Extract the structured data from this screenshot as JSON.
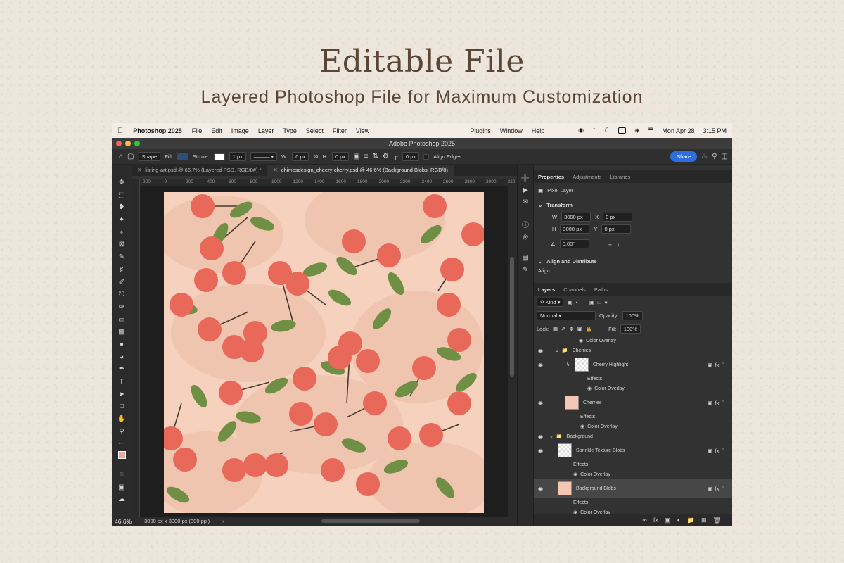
{
  "hero": {
    "title": "Editable File",
    "subtitle": "Layered Photoshop File for Maximum Customization"
  },
  "menubar": {
    "app_name": "Photoshop 2025",
    "items": [
      "File",
      "Edit",
      "Image",
      "Layer",
      "Type",
      "Select",
      "Filter",
      "View"
    ],
    "right_items": [
      "Plugins",
      "Window",
      "Help"
    ],
    "date": "Mon Apr 28",
    "time": "3:15 PM"
  },
  "window": {
    "title": "Adobe Photoshop 2025"
  },
  "optionsbar": {
    "shape_mode": "Shape",
    "fill_label": "Fill:",
    "stroke_label": "Stroke:",
    "stroke_width": "1 px",
    "w_label": "W:",
    "w_value": "0 px",
    "h_label": "H:",
    "h_value": "0 px",
    "corner_value": "0 px",
    "align_edges": "Align Edges",
    "share": "Share"
  },
  "tabs": [
    {
      "label": "listing-art.psd @ 66.7% (Layered PSD, RGB/8#) *"
    },
    {
      "label": "chimesdesign_cheery-cherry.psd @ 46.6% (Background Blobs, RGB/8)"
    }
  ],
  "ruler": [
    "200",
    "0",
    "200",
    "400",
    "600",
    "800",
    "1000",
    "1200",
    "1400",
    "1600",
    "1800",
    "2000",
    "2200",
    "2400",
    "2600",
    "2800",
    "3000",
    "320"
  ],
  "status": {
    "zoom": "46.6%",
    "doc_size": "3000 px x 3000 px (300 ppi)"
  },
  "properties": {
    "tabs": [
      "Properties",
      "Adjustments",
      "Libraries"
    ],
    "kind": "Pixel Layer",
    "transform": "Transform",
    "w": "3000 px",
    "h": "3000 px",
    "x": "0 px",
    "y": "0 px",
    "angle": "0.00°",
    "align_distribute": "Align and Distribute",
    "align_label": "Align:"
  },
  "layers": {
    "tabs": [
      "Layers",
      "Channels",
      "Paths"
    ],
    "filter": "Kind",
    "blend": "Normal",
    "opacity_label": "Opacity:",
    "opacity": "100%",
    "lock_label": "Lock:",
    "fill_label": "Fill:",
    "fill": "100%",
    "rows": {
      "top_overlay": "Color Overlay",
      "group_cherries": "Cherries",
      "cherry_highlight": "Cherry Highlight",
      "effects1": "Effects",
      "overlay1": "Color Overlay",
      "cherries": "Cherries",
      "effects2": "Effects",
      "overlay2": "Color Overlay",
      "group_background": "Background",
      "sprinkle": "Sprinkle Texture Blobs",
      "effects3": "Effects",
      "overlay3": "Color Overlay",
      "bg_blobs": "Background Blobs",
      "effects4": "Effects",
      "overlay4": "Color Overlay"
    }
  },
  "colors": {
    "artboard_bg": "#f6d1bd",
    "cherry": "#e8685a",
    "leaf": "#6f8f45",
    "blob": "#eec0aa",
    "share": "#2c6fe0"
  }
}
